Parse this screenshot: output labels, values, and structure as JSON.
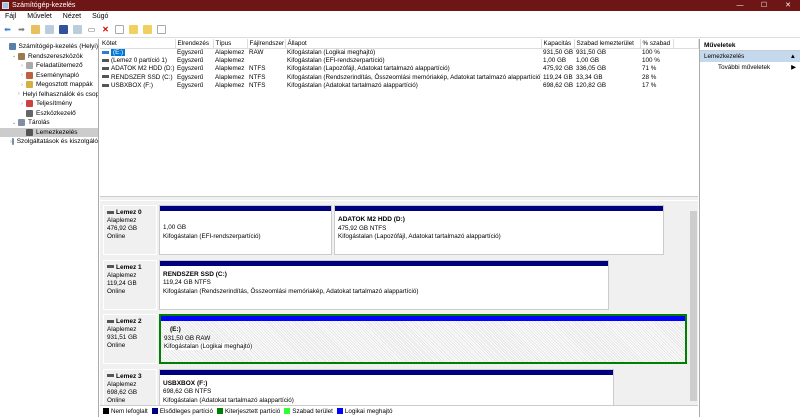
{
  "window": {
    "title": "Számítógép-kezelés",
    "minimize": "—",
    "maximize": "☐",
    "close": "✕"
  },
  "menu": [
    "Fájl",
    "Művelet",
    "Nézet",
    "Súgó"
  ],
  "tree": [
    {
      "label": "Számítógép-kezelés (Helyi)",
      "level": 0,
      "arrow": "",
      "color": "#5a7fa8"
    },
    {
      "label": "Rendszereszközök",
      "level": 1,
      "arrow": "⌄",
      "color": "#9a7a50"
    },
    {
      "label": "Feladatütemező",
      "level": 2,
      "arrow": "›",
      "color": "#aaa"
    },
    {
      "label": "Eseménynapló",
      "level": 2,
      "arrow": "›",
      "color": "#c06040"
    },
    {
      "label": "Megosztott mappák",
      "level": 2,
      "arrow": "›",
      "color": "#d4b040"
    },
    {
      "label": "Helyi felhasználók és csop",
      "level": 2,
      "arrow": "›",
      "color": "#5080c0"
    },
    {
      "label": "Teljesítmény",
      "level": 2,
      "arrow": "›",
      "color": "#d04040"
    },
    {
      "label": "Eszközkezelő",
      "level": 2,
      "arrow": "",
      "color": "#666"
    },
    {
      "label": "Tárolás",
      "level": 1,
      "arrow": "⌄",
      "color": "#8090a0"
    },
    {
      "label": "Lemezkezelés",
      "level": 2,
      "arrow": "",
      "color": "#555",
      "selected": true
    },
    {
      "label": "Szolgáltatások és kiszolgáló",
      "level": 1,
      "arrow": "›",
      "color": "#7090b0"
    }
  ],
  "table": {
    "headers": [
      "Kötet",
      "Elrendezés",
      "Típus",
      "Fájlrendszer",
      "Állapot",
      "Kapacitás",
      "Szabad lemezterület",
      "% szabad"
    ],
    "rows": [
      [
        "(E:)",
        "Egyszerű",
        "Alaplemez",
        "RAW",
        "Kifogástalan (Logikai meghajtó)",
        "931,50 GB",
        "931,50 GB",
        "100 %"
      ],
      [
        "(Lemez 0 partíció 1)",
        "Egyszerű",
        "Alaplemez",
        "",
        "Kifogástalan (EFI-rendszerpartíció)",
        "1,00 GB",
        "1,00 GB",
        "100 %"
      ],
      [
        "ADATOK M2 HDD (D:)",
        "Egyszerű",
        "Alaplemez",
        "NTFS",
        "Kifogástalan (Lapozófájl, Adatokat tartalmazó alappartíció)",
        "475,92 GB",
        "336,05 GB",
        "71 %"
      ],
      [
        "RENDSZER SSD (C:)",
        "Egyszerű",
        "Alaplemez",
        "NTFS",
        "Kifogástalan (Rendszerindítás, Összeomlási memóriakép, Adatokat tartalmazó alappartíció)",
        "119,24 GB",
        "33,34 GB",
        "28 %"
      ],
      [
        "USBXBOX (F:)",
        "Egyszerű",
        "Alaplemez",
        "NTFS",
        "Kifogástalan (Adatokat tartalmazó alappartíció)",
        "698,62 GB",
        "120,82 GB",
        "17 %"
      ]
    ]
  },
  "disks": [
    {
      "name": "Lemez 0",
      "type": "Alaplemez",
      "size": "476,92 GB",
      "status": "Online",
      "partitions": [
        {
          "title": "",
          "size": "1,00 GB",
          "status": "Kifogástalan (EFI-rendszerpartíció)"
        },
        {
          "title": "ADATOK M2 HDD  (D:)",
          "size": "475,92 GB NTFS",
          "status": "Kifogástalan (Lapozófájl, Adatokat tartalmazó alappartíció)"
        }
      ]
    },
    {
      "name": "Lemez 1",
      "type": "Alaplemez",
      "size": "119,24 GB",
      "status": "Online",
      "partitions": [
        {
          "title": "RENDSZER SSD  (C:)",
          "size": "119,24 GB NTFS",
          "status": "Kifogástalan (Rendszerindítás, Összeomlási memóriakép, Adatokat tartalmazó alappartíció)"
        }
      ]
    },
    {
      "name": "Lemez 2",
      "type": "Alaplemez",
      "size": "931,51 GB",
      "status": "Online",
      "partitions": [
        {
          "title": "(E:)",
          "size": "931,50 GB RAW",
          "status": "Kifogástalan (Logikai meghajtó)"
        }
      ]
    },
    {
      "name": "Lemez 3",
      "type": "Alaplemez",
      "size": "698,62 GB",
      "status": "Online",
      "partitions": [
        {
          "title": "USBXBOX  (F:)",
          "size": "698,62 GB NTFS",
          "status": "Kifogástalan (Adatokat tartalmazó alappartíció)"
        }
      ]
    }
  ],
  "legend": [
    {
      "label": "Nem lefoglalt",
      "color": "#000000"
    },
    {
      "label": "Elsődleges partíció",
      "color": "#00007f"
    },
    {
      "label": "Kiterjesztett partíció",
      "color": "#008000"
    },
    {
      "label": "Szabad terület",
      "color": "#33ff33"
    },
    {
      "label": "Logikai meghajtó",
      "color": "#0000ff"
    }
  ],
  "actions": {
    "header": "Műveletek",
    "section": "Lemezkezelés",
    "item": "További műveletek"
  }
}
